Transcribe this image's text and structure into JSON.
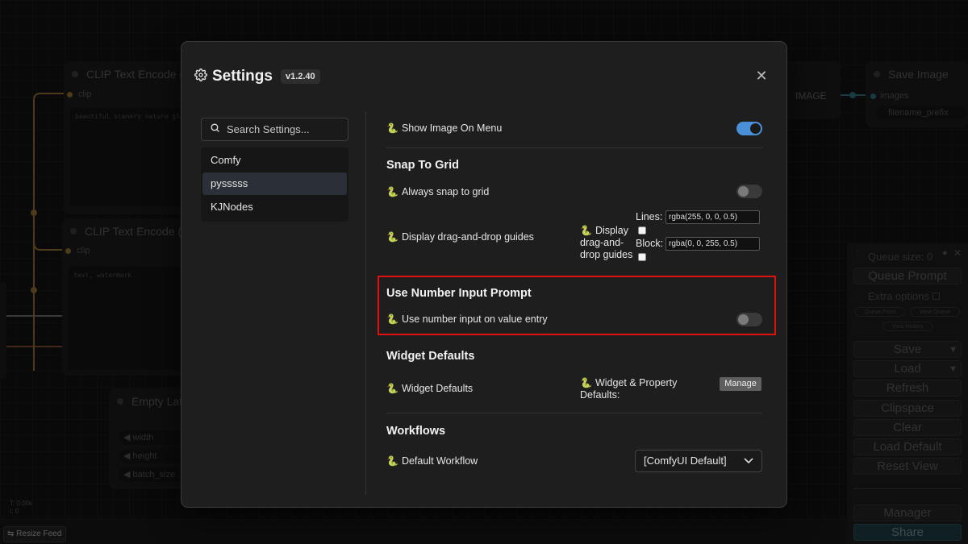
{
  "background": {
    "nodes": {
      "clip1_title": "CLIP Text Encode (",
      "clip1_slot": "clip",
      "clip1_text": "beautiful scenery nature gla",
      "clip2_title": "CLIP Text Encode (",
      "clip2_slot": "clip",
      "clip2_text": "text, watermark",
      "latent_title": "Empty Lat",
      "latent_widgets": [
        "width",
        "height",
        "batch_size"
      ],
      "save_title": "Save Image",
      "save_slot": "images",
      "save_widget": "filename_prefix",
      "image_label": "IMAGE"
    },
    "queue": {
      "size_label": "Queue size: 0",
      "queue_prompt": "Queue Prompt",
      "extra_options": "Extra options",
      "queue_front": "Queue Front",
      "view_queue": "View Queue",
      "view_history": "View History",
      "save": "Save",
      "load": "Load",
      "refresh": "Refresh",
      "clipspace": "Clipspace",
      "clear": "Clear",
      "load_default": "Load Default",
      "reset_view": "Reset View",
      "manager": "Manager",
      "share": "Share"
    },
    "resize_feed": "Resize Feed",
    "stats": [
      "T: 0.00s",
      "I: 0"
    ]
  },
  "dialog": {
    "title": "Settings",
    "version": "v1.2.40",
    "search_placeholder": "Search Settings...",
    "categories": [
      {
        "label": "Comfy",
        "active": false
      },
      {
        "label": "pysssss",
        "active": true
      },
      {
        "label": "KJNodes",
        "active": false
      }
    ],
    "show_image_on_menu": {
      "label": "Show Image On Menu",
      "enabled": true
    },
    "snap_to_grid": {
      "section": "Snap To Grid",
      "always_snap": {
        "label": "Always snap to grid",
        "enabled": false
      },
      "guides_label": "Display drag-and-drop guides",
      "guides_inner_line1": "Display",
      "guides_inner_line2": "drag-and-",
      "guides_inner_line3": "drop guides",
      "lines_label": "Lines:",
      "lines_value": "rgba(255, 0, 0, 0.5)",
      "block_label": "Block:",
      "block_value": "rgba(0, 0, 255, 0.5)"
    },
    "number_input": {
      "section": "Use Number Input Prompt",
      "label": "Use number input on value entry",
      "enabled": false
    },
    "widget_defaults": {
      "section": "Widget Defaults",
      "label": "Widget Defaults",
      "inner_line1": "Widget & Property",
      "inner_line2": "Defaults:",
      "manage": "Manage"
    },
    "workflows": {
      "section": "Workflows",
      "label": "Default Workflow",
      "selected": "[ComfyUI Default]"
    }
  },
  "colors": {
    "accent": "#4a90d9",
    "highlight": "#e01010",
    "python_icon": "#c9b458"
  },
  "icons": {
    "settings": "gear-icon",
    "close": "close-icon",
    "search": "search-icon",
    "python": "python-icon",
    "dropdown": "chevron-down-icon"
  }
}
